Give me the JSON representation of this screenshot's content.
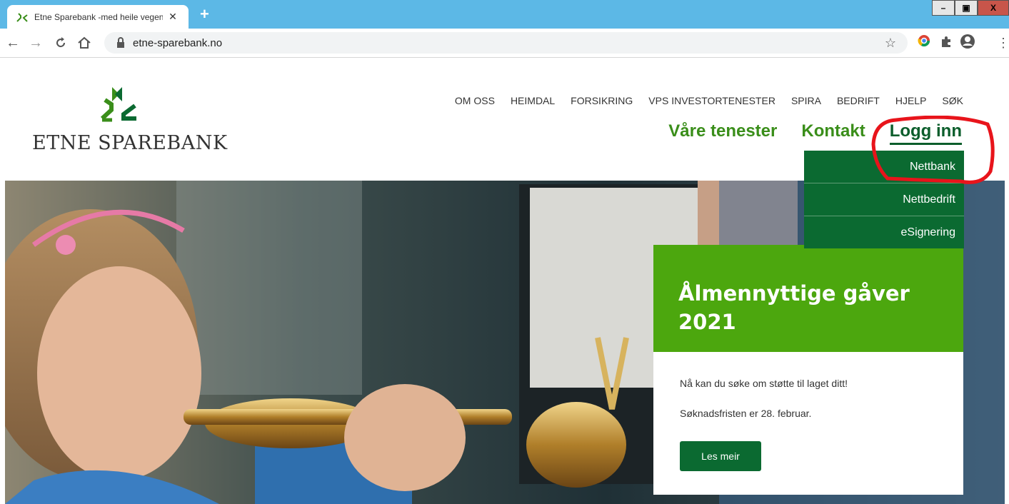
{
  "browser": {
    "tab_title": "Etne Sparebank -med heile vegen",
    "tab_close": "✕",
    "new_tab": "+",
    "url": "etne-sparebank.no",
    "window_controls": {
      "minimize": "–",
      "maximize": "▣",
      "close": "X"
    },
    "nav_icons": [
      "back-icon",
      "forward-icon",
      "reload-icon",
      "home-icon"
    ]
  },
  "site": {
    "logo_text": "ETNE SPAREBANK",
    "top_nav": [
      "OM OSS",
      "HEIMDAL",
      "FORSIKRING",
      "VPS INVESTORTENESTER",
      "SPIRA",
      "BEDRIFT",
      "HJELP",
      "SØK"
    ],
    "main_nav": {
      "services": "Våre tenester",
      "contact": "Kontakt",
      "login": "Logg inn"
    },
    "login_menu": [
      "Nettbank",
      "Nettbedrift",
      "eSignering"
    ]
  },
  "promo": {
    "title_line1": "Ålmennyttige gåver",
    "title_line2": "2021",
    "text1": "Nå kan du søke om støtte til laget ditt!",
    "text2": "Søknadsfristen er 28. februar.",
    "button": "Les meir"
  },
  "colors": {
    "brand_green": "#4ca70e",
    "dark_green": "#0b6a31",
    "chrome_blue": "#5cb8e6",
    "annotation_red": "#e8141b"
  }
}
